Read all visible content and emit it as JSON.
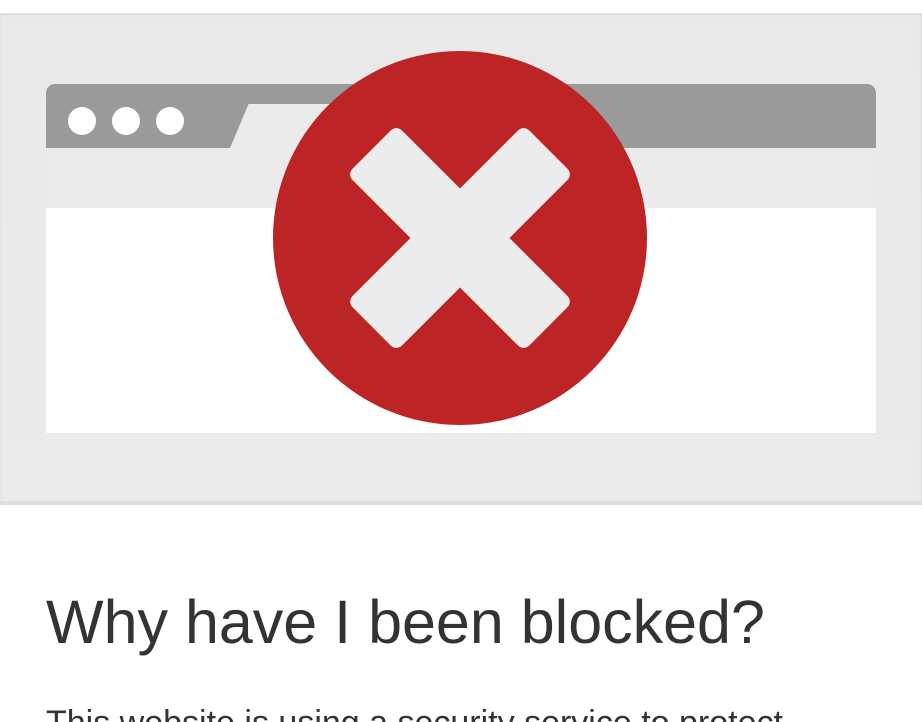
{
  "colors": {
    "band_background": "#ebebeb",
    "titlebar": "#9a9a9a",
    "block_icon_fill": "#bd2426",
    "block_icon_mark": "#ececec",
    "text": "#333333"
  },
  "illustration": {
    "window_controls": [
      "dot",
      "dot",
      "dot"
    ],
    "icon": "close-x-circle-icon"
  },
  "heading": "Why have I been blocked?",
  "body_text": "This website is using a security service to protect"
}
